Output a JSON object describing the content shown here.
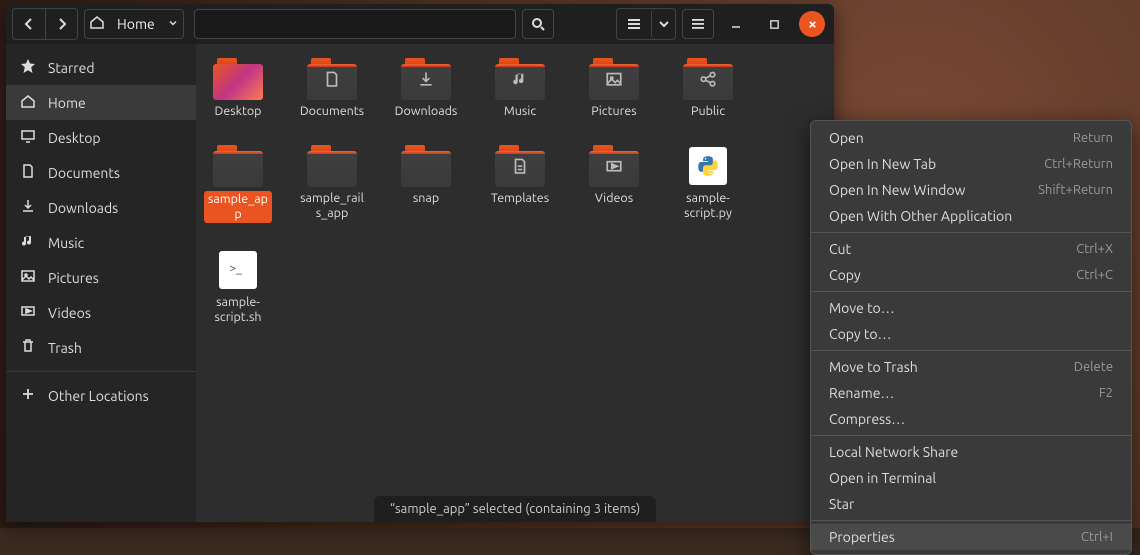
{
  "path": {
    "label": "Home"
  },
  "sidebar": {
    "items": [
      {
        "id": "starred",
        "label": "Starred",
        "icon": "star"
      },
      {
        "id": "home",
        "label": "Home",
        "icon": "home",
        "active": true
      },
      {
        "id": "desktop",
        "label": "Desktop",
        "icon": "desktop"
      },
      {
        "id": "documents",
        "label": "Documents",
        "icon": "document"
      },
      {
        "id": "downloads",
        "label": "Downloads",
        "icon": "download"
      },
      {
        "id": "music",
        "label": "Music",
        "icon": "music"
      },
      {
        "id": "pictures",
        "label": "Pictures",
        "icon": "picture"
      },
      {
        "id": "videos",
        "label": "Videos",
        "icon": "video"
      },
      {
        "id": "trash",
        "label": "Trash",
        "icon": "trash"
      }
    ],
    "other_locations": "Other Locations"
  },
  "files": [
    {
      "name": "Desktop",
      "type": "folder-desktop"
    },
    {
      "name": "Documents",
      "type": "folder",
      "emblem": "document"
    },
    {
      "name": "Downloads",
      "type": "folder",
      "emblem": "download"
    },
    {
      "name": "Music",
      "type": "folder",
      "emblem": "music"
    },
    {
      "name": "Pictures",
      "type": "folder",
      "emblem": "picture"
    },
    {
      "name": "Public",
      "type": "folder",
      "emblem": "share"
    },
    {
      "name": "sample_app",
      "type": "folder",
      "selected": true
    },
    {
      "name": "sample_rails_app",
      "type": "folder"
    },
    {
      "name": "snap",
      "type": "folder"
    },
    {
      "name": "Templates",
      "type": "folder",
      "emblem": "template"
    },
    {
      "name": "Videos",
      "type": "folder",
      "emblem": "video"
    },
    {
      "name": "sample-script.py",
      "type": "file-python"
    },
    {
      "name": "sample-script.sh",
      "type": "file-shell"
    }
  ],
  "status": "“sample_app” selected  (containing 3 items)",
  "context_menu": [
    {
      "label": "Open",
      "shortcut": "Return"
    },
    {
      "label": "Open In New Tab",
      "shortcut": "Ctrl+Return"
    },
    {
      "label": "Open In New Window",
      "shortcut": "Shift+Return"
    },
    {
      "label": "Open With Other Application"
    },
    {
      "sep": true
    },
    {
      "label": "Cut",
      "shortcut": "Ctrl+X"
    },
    {
      "label": "Copy",
      "shortcut": "Ctrl+C"
    },
    {
      "sep": true
    },
    {
      "label": "Move to…"
    },
    {
      "label": "Copy to…"
    },
    {
      "sep": true
    },
    {
      "label": "Move to Trash",
      "shortcut": "Delete"
    },
    {
      "label": "Rename…",
      "shortcut": "F2"
    },
    {
      "label": "Compress…"
    },
    {
      "sep": true
    },
    {
      "label": "Local Network Share"
    },
    {
      "label": "Open in Terminal"
    },
    {
      "label": "Star"
    },
    {
      "sep": true
    },
    {
      "label": "Properties",
      "shortcut": "Ctrl+I",
      "hovered": true
    }
  ]
}
